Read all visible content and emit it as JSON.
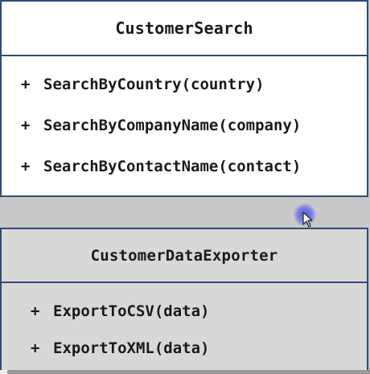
{
  "diagram": {
    "classes": [
      {
        "name": "CustomerSearch",
        "methods": [
          {
            "visibility": "+",
            "signature": "SearchByCountry(country)"
          },
          {
            "visibility": "+",
            "signature": "SearchByCompanyName(company)"
          },
          {
            "visibility": "+",
            "signature": "SearchByContactName(contact)"
          }
        ]
      },
      {
        "name": "CustomerDataExporter",
        "methods": [
          {
            "visibility": "+",
            "signature": "ExportToCSV(data)"
          },
          {
            "visibility": "+",
            "signature": "ExportToXML(data)"
          }
        ]
      }
    ]
  },
  "colors": {
    "border": "#2f4a78",
    "class1_background": "#ffffff",
    "class2_background": "#d8d8d8",
    "cursor_highlight": "#4650e6"
  },
  "icons": {
    "cursor": "cursor-arrow-icon"
  },
  "video_progress": {
    "fraction": 0.02
  }
}
